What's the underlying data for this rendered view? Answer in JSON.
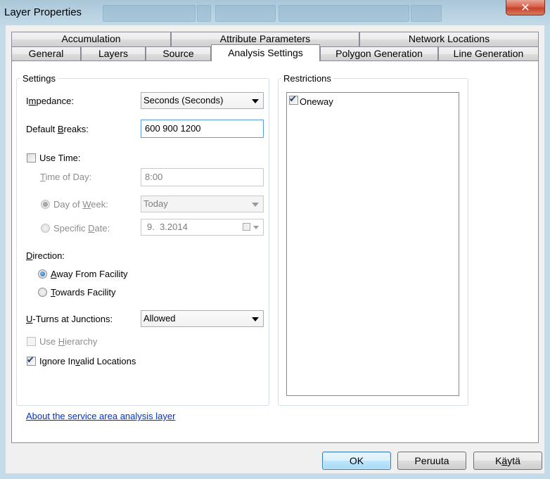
{
  "window": {
    "title": "Layer Properties",
    "close_glyph": "✕"
  },
  "tabs_row1": [
    {
      "label": "Accumulation"
    },
    {
      "label": "Attribute Parameters"
    },
    {
      "label": "Network Locations"
    }
  ],
  "tabs_row2": [
    {
      "label": "General"
    },
    {
      "label": "Layers"
    },
    {
      "label": "Source"
    },
    {
      "label": "Analysis Settings"
    },
    {
      "label": "Polygon Generation"
    },
    {
      "label": "Line Generation"
    }
  ],
  "settings": {
    "group_title": "Settings",
    "impedance": {
      "label_pre": "I",
      "label_acc": "m",
      "label_post": "pedance:",
      "value": "Seconds (Seconds)"
    },
    "default_breaks": {
      "label_pre": "Default ",
      "label_acc": "B",
      "label_post": "reaks:",
      "value": "600 900 1200"
    },
    "use_time": {
      "label": "Use Time:",
      "checked": false
    },
    "time_of_day": {
      "label_acc": "T",
      "label_post": "ime of Day:",
      "value": "8:00"
    },
    "day_of_week": {
      "label_pre": "Day of ",
      "label_acc": "W",
      "label_post": "eek:",
      "value": "Today"
    },
    "specific_date": {
      "label_pre": "Specific ",
      "label_acc": "D",
      "label_post": "ate:",
      "value": "9.  3.2014"
    },
    "direction": {
      "label_acc": "D",
      "label_post": "irection:"
    },
    "away_from_facility": {
      "label_acc": "A",
      "label_post": "way From Facility",
      "selected": true
    },
    "towards_facility": {
      "label_acc": "T",
      "label_post": "owards Facility",
      "selected": false
    },
    "u_turns": {
      "label_acc": "U",
      "label_post": "-Turns at Junctions:",
      "value": "Allowed"
    },
    "use_hierarchy": {
      "label_pre": "Use ",
      "label_acc": "H",
      "label_post": "ierarchy",
      "checked": false
    },
    "ignore_invalid": {
      "label_pre": "Ignore In",
      "label_acc": "v",
      "label_post": "alid Locations",
      "checked": true
    }
  },
  "restrictions": {
    "group_title": "Restrictions",
    "items": [
      {
        "label": "Oneway",
        "checked": true
      }
    ]
  },
  "link": {
    "text": "About the service area analysis layer"
  },
  "buttons": {
    "ok": "OK",
    "cancel": "Peruuta",
    "apply_pre": "K",
    "apply_acc": "ä",
    "apply_post": "ytä"
  },
  "check_glyph": "✔"
}
